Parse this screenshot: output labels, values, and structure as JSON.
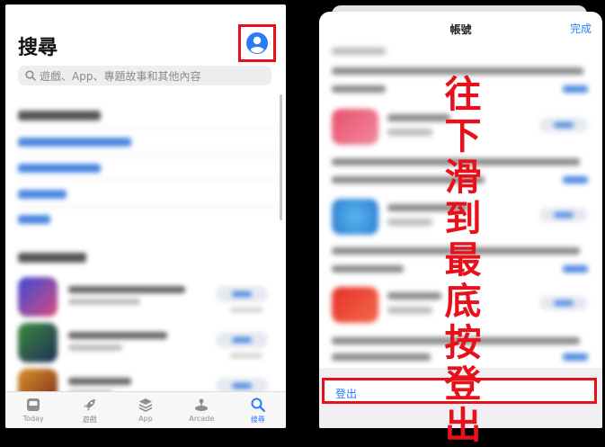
{
  "left": {
    "title": "搜尋",
    "search_placeholder": "遊戲、App、專題故事和其他內容",
    "tabs": [
      {
        "label": "Today",
        "icon": "today-icon"
      },
      {
        "label": "遊戲",
        "icon": "rocket-icon"
      },
      {
        "label": "App",
        "icon": "layers-icon"
      },
      {
        "label": "Arcade",
        "icon": "joystick-icon"
      },
      {
        "label": "搜尋",
        "icon": "search-icon",
        "active": true
      }
    ]
  },
  "right": {
    "title": "帳號",
    "done_label": "完成",
    "logout_label": "登出"
  },
  "annotation": {
    "text": "往下滑到最底按登出",
    "color": "#e8101a"
  },
  "colors": {
    "accent": "#2a7cf6",
    "highlight_border": "#e8101a"
  }
}
